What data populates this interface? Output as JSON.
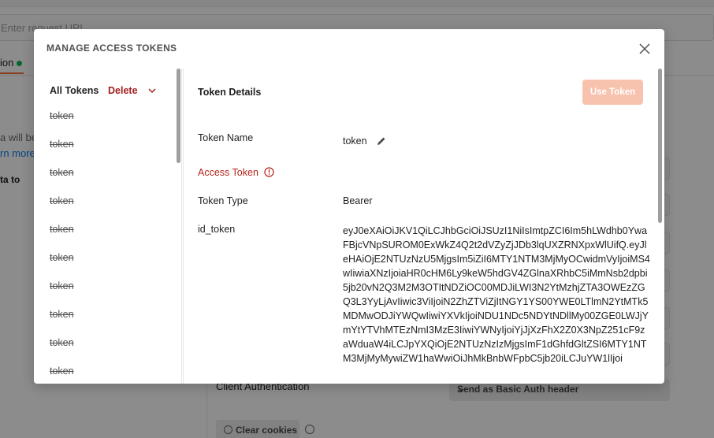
{
  "background": {
    "url_placeholder": "Enter request URL",
    "active_tab": "ion",
    "text1": "a will be",
    "link": "rn more",
    "text2": "ta to",
    "client_auth_label": "Client Authentication",
    "client_auth_value": "Send as Basic Auth header",
    "clear_cookies_label": "Clear cookies"
  },
  "modal": {
    "title": "MANAGE ACCESS TOKENS",
    "left": {
      "header": "All Tokens",
      "delete_label": "Delete",
      "tokens": [
        "token",
        "token",
        "token",
        "token",
        "token",
        "token",
        "token",
        "token",
        "token",
        "token"
      ]
    },
    "details": {
      "section_title": "Token Details",
      "use_token_label": "Use Token",
      "token_name_label": "Token Name",
      "token_name_value": "token",
      "access_token_label": "Access Token",
      "token_type_label": "Token Type",
      "token_type_value": "Bearer",
      "id_token_label": "id_token",
      "id_token_value": "eyJ0eXAiOiJKV1QiLCJhbGciOiJSUzI1NiIsImtpZCI6Im5hLWdhb0YwaFBjcVNpSUROM0ExWkZ4Q2t2dVZyZjJDb3lqUXZRNXpxWlUifQ.eyJleHAiOjE2NTUzNzU5MjgsIm5iZiI6MTY1NTM3MjMyOCwidmVyIjoiMS4wIiwiaXNzIjoiaHR0cHM6Ly9keW5hdGV4ZGlnaXRhbC5iMmNsb2dpbi5jb20vN2Q3M2M3OTItNDZiOC00MDJiLWI3N2YtMzhjZTA3OWEzZGQ3L3YyLjAvIiwic3ViIjoiN2ZhZTViZjItNGY1YS00YWE0LTlmN2YtMTk5MDMwODJiYWQwIiwiYXVkIjoiNDU1NDc5NDYtNDllMy00ZGE0LWJjYmYtYTVhMTEzNmI3MzE3IiwiYWNyIjoiYjJjXzFhX2Z0X3NpZ251cF9zaWduaW4iLCJpYXQiOjE2NTUzNzIzMjgsImF1dGhfdGltZSI6MTY1NTM3MjMyMywiZW1haWwiOiJhMkBnbWFpbC5jb20iLCJuYW1lIjoi"
    }
  }
}
